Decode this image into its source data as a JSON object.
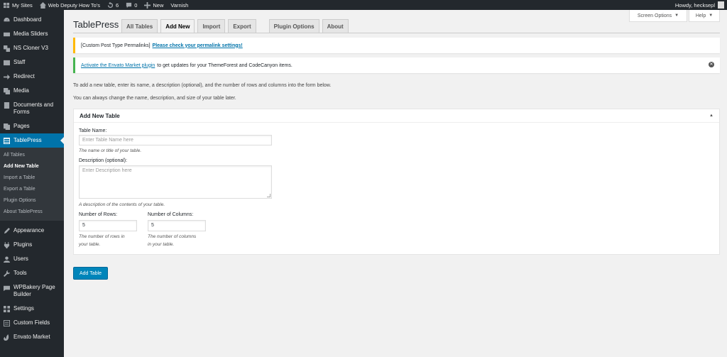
{
  "admin_bar": {
    "my_sites": "My Sites",
    "site_name": "Web Deputy How To's",
    "updates_count": "6",
    "comments_count": "0",
    "new_label": "New",
    "varnish_label": "Varnish",
    "howdy": "Howdy, hecksepl"
  },
  "sidebar": {
    "items_top": [
      {
        "label": "Dashboard",
        "icon": "dashboard-icon"
      },
      {
        "label": "Media Sliders",
        "icon": "media-sliders-icon"
      },
      {
        "label": "NS Cloner V3",
        "icon": "cloner-icon"
      },
      {
        "label": "Staff",
        "icon": "staff-icon"
      },
      {
        "label": "Redirect",
        "icon": "redirect-icon"
      },
      {
        "label": "Media",
        "icon": "media-icon"
      },
      {
        "label": "Documents and Forms",
        "icon": "documents-icon"
      },
      {
        "label": "Pages",
        "icon": "pages-icon"
      }
    ],
    "active": {
      "label": "TablePress",
      "icon": "tablepress-icon"
    },
    "submenu": [
      "All Tables",
      "Add New Table",
      "Import a Table",
      "Export a Table",
      "Plugin Options",
      "About TablePress"
    ],
    "submenu_current_index": 1,
    "items_bottom": [
      {
        "label": "Appearance",
        "icon": "appearance-icon"
      },
      {
        "label": "Plugins",
        "icon": "plugins-icon"
      },
      {
        "label": "Users",
        "icon": "users-icon"
      },
      {
        "label": "Tools",
        "icon": "tools-icon"
      },
      {
        "label": "WPBakery Page Builder",
        "icon": "wpbakery-icon"
      },
      {
        "label": "Settings",
        "icon": "settings-icon"
      },
      {
        "label": "Custom Fields",
        "icon": "custom-fields-icon"
      },
      {
        "label": "Envato Market",
        "icon": "envato-icon"
      }
    ]
  },
  "screen_meta": {
    "screen_options": "Screen Options",
    "help": "Help"
  },
  "page": {
    "title": "TablePress",
    "tabs": [
      "All Tables",
      "Add New",
      "Import",
      "Export",
      "Plugin Options",
      "About"
    ],
    "active_tab_index": 1
  },
  "notices": {
    "permalinks_prefix": "[Custom Post Type Permalinks]",
    "permalinks_link": "Please check your permalink settings!",
    "envato_link": "Activate the Envato Market plugin",
    "envato_text": "to get updates for your ThemeForest and CodeCanyon items."
  },
  "intro": {
    "line1": "To add a new table, enter its name, a description (optional), and the number of rows and columns into the form below.",
    "line2": "You can always change the name, description, and size of your table later."
  },
  "form": {
    "box_title": "Add New Table",
    "table_name_label": "Table Name:",
    "table_name_placeholder": "Enter Table Name here",
    "table_name_desc": "The name or title of your table.",
    "description_label": "Description (optional):",
    "description_placeholder": "Enter Description here",
    "description_desc": "A description of the contents of your table.",
    "rows_label": "Number of Rows:",
    "rows_value": "5",
    "rows_desc_1": "The number of rows in",
    "rows_desc_2": "your table.",
    "cols_label": "Number of Columns:",
    "cols_value": "5",
    "cols_desc_1": "The number of columns",
    "cols_desc_2": "in your table.",
    "submit_label": "Add Table"
  },
  "colors": {
    "accent": "#0073aa",
    "button": "#0085ba",
    "warning": "#ffb900",
    "success": "#46b450"
  }
}
